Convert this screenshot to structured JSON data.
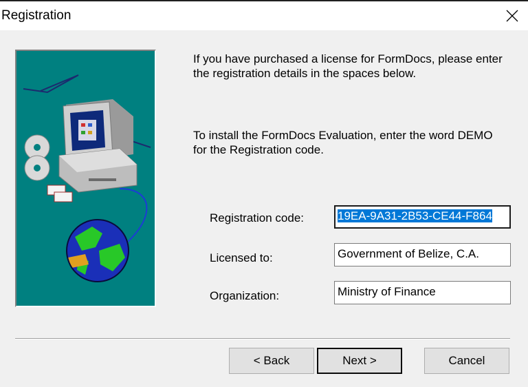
{
  "window": {
    "title": "Registration"
  },
  "instructions": {
    "paragraph1": "If you have purchased a license for FormDocs, please enter the registration details in the spaces below.",
    "paragraph2": "To install the FormDocs Evaluation, enter the word DEMO for the Registration code."
  },
  "form": {
    "registration_code": {
      "label": "Registration code:",
      "value": "19EA-9A31-2B53-CE44-F864"
    },
    "licensed_to": {
      "label": "Licensed to:",
      "value": "Government of Belize, C.A."
    },
    "organization": {
      "label": "Organization:",
      "value": "Ministry of Finance"
    }
  },
  "buttons": {
    "back": "< Back",
    "next": "Next >",
    "cancel": "Cancel"
  },
  "icons": {
    "close": "close-icon",
    "illustration": "computer-globe-illustration"
  },
  "colors": {
    "illustration_bg": "#008080",
    "selection": "#0078d7"
  }
}
